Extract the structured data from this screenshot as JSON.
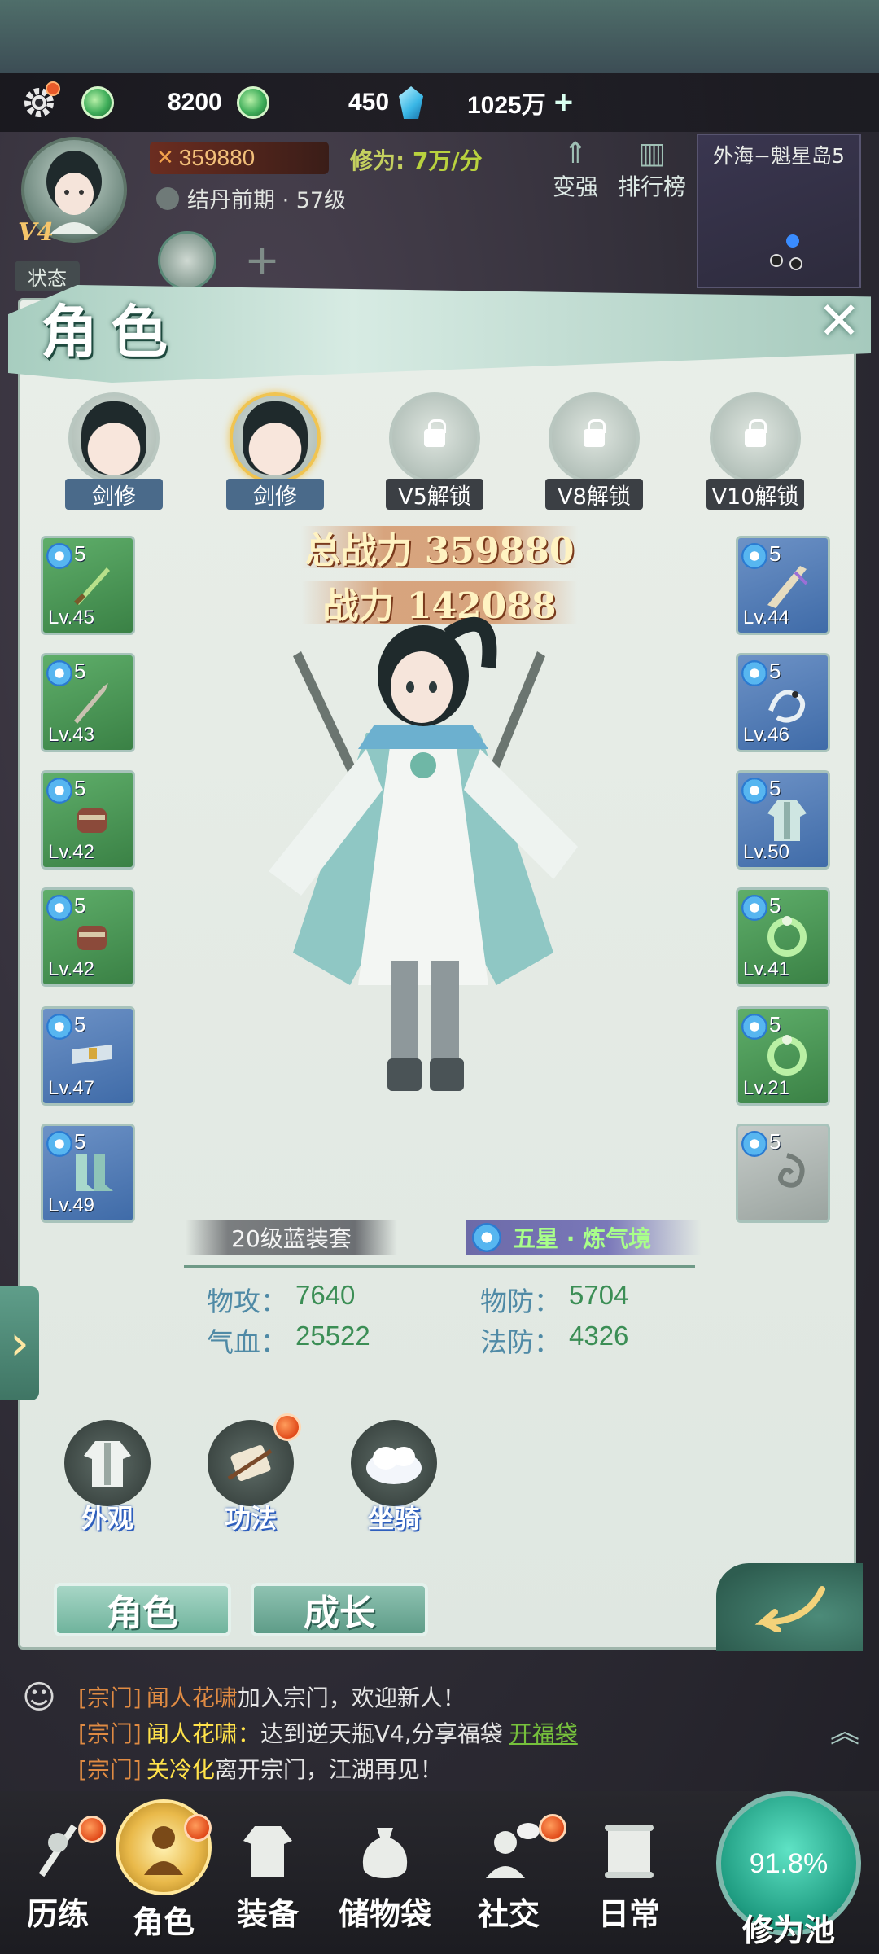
{
  "resources": {
    "jade_count": "8200",
    "spirit_count": "450",
    "silver_count": "1025万"
  },
  "player": {
    "vip": "V4",
    "state_label": "状态",
    "combat_power": "359880",
    "cultivation_label": "修为:",
    "cultivation_rate": "7万/分",
    "realm": "结丹前期 · 57级"
  },
  "top_buttons": {
    "strengthen": "变强",
    "ranking": "排行榜"
  },
  "minimap": {
    "location": "外海−魁星岛5"
  },
  "panel": {
    "title": "角色",
    "characters": [
      {
        "label": "剑修",
        "locked": false
      },
      {
        "label": "剑修",
        "locked": false
      },
      {
        "label": "V5解锁",
        "locked": true
      },
      {
        "label": "V8解锁",
        "locked": true
      },
      {
        "label": "V10解锁",
        "locked": true
      }
    ],
    "total_power": "总战力 359880",
    "power": "战力 142088",
    "left_equipment": [
      {
        "star": "5",
        "level": "Lv.45",
        "rarity": "green",
        "icon": "sword-icon"
      },
      {
        "star": "5",
        "level": "Lv.43",
        "rarity": "green",
        "icon": "blade-icon"
      },
      {
        "star": "5",
        "level": "Lv.42",
        "rarity": "green",
        "icon": "bracer-icon"
      },
      {
        "star": "5",
        "level": "Lv.42",
        "rarity": "green",
        "icon": "bracer-icon"
      },
      {
        "star": "5",
        "level": "Lv.47",
        "rarity": "blue",
        "icon": "belt-icon"
      },
      {
        "star": "5",
        "level": "Lv.49",
        "rarity": "blue",
        "icon": "boots-icon"
      }
    ],
    "right_equipment": [
      {
        "star": "5",
        "level": "Lv.44",
        "rarity": "blue",
        "icon": "greatsword-icon"
      },
      {
        "star": "5",
        "level": "Lv.46",
        "rarity": "blue",
        "icon": "dragon-icon"
      },
      {
        "star": "5",
        "level": "Lv.50",
        "rarity": "blue",
        "icon": "robe-icon"
      },
      {
        "star": "5",
        "level": "Lv.41",
        "rarity": "green",
        "icon": "ring-icon"
      },
      {
        "star": "5",
        "level": "Lv.21",
        "rarity": "green",
        "icon": "ring-icon"
      },
      {
        "star": "5",
        "level": "",
        "rarity": "gray",
        "icon": "swirl-icon"
      }
    ],
    "set_label": "20级蓝装套",
    "realm_label": "五星 · 炼气境",
    "stats": {
      "phys_atk_label": "物攻：",
      "phys_atk": "7640",
      "phys_def_label": "物防：",
      "phys_def": "5704",
      "hp_label": "气血：",
      "hp": "25522",
      "mag_def_label": "法防：",
      "mag_def": "4326"
    },
    "features": [
      {
        "label": "外观"
      },
      {
        "label": "功法"
      },
      {
        "label": "坐骑"
      }
    ],
    "tabs": {
      "role": "角色",
      "growth": "成长"
    }
  },
  "chat": [
    {
      "tag": "[宗门]",
      "name": "闻人花啸",
      "text": "加入宗门，欢迎新人！"
    },
    {
      "tag": "[宗门]",
      "name": "闻人花啸：",
      "text": "达到逆天瓶V4,分享福袋",
      "link": "开福袋"
    },
    {
      "tag": "[宗门]",
      "name": "关冷化",
      "text": "离开宗门，江湖再见！"
    }
  ],
  "nav": {
    "items": [
      "历练",
      "角色",
      "装备",
      "储物袋",
      "社交",
      "日常"
    ],
    "pool_percent": "91.8%",
    "pool_label": "修为池"
  },
  "colors": {
    "panel_bg": "#e9eee8",
    "accent_green": "#6fb39c",
    "stat_value": "#3b8e55",
    "gold": "#f0c451"
  }
}
